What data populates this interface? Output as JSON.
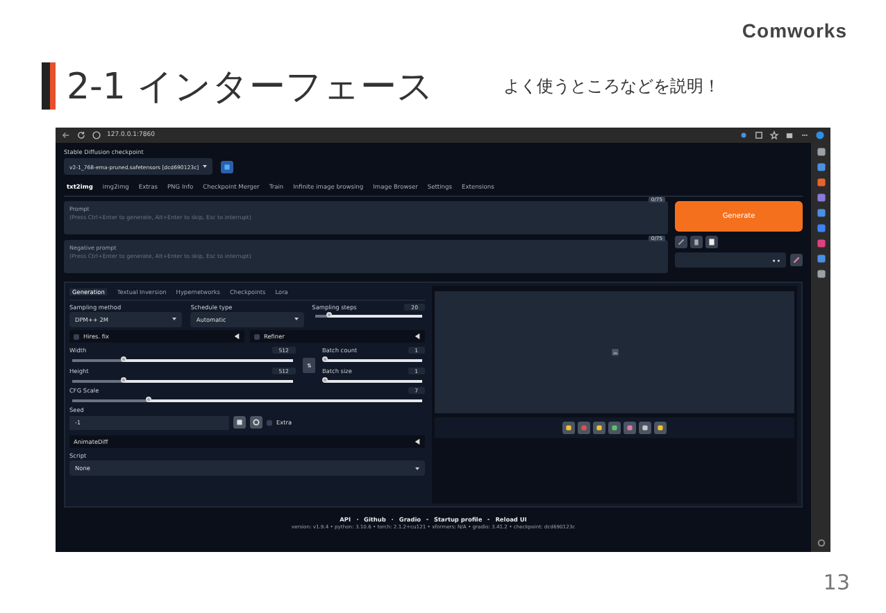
{
  "slide": {
    "logo": "Comworks",
    "title": "2-1 インターフェース",
    "subtitle": "よく使うところなどを説明！",
    "page_number": "13"
  },
  "browser": {
    "address": "127.0.0.1:7860"
  },
  "checkpoint": {
    "label": "Stable Diffusion checkpoint",
    "value": "v2-1_768-ema-pruned.safetensors [dcd690123c]"
  },
  "tabs": [
    {
      "label": "txt2img",
      "selected": true
    },
    {
      "label": "img2img",
      "selected": false
    },
    {
      "label": "Extras",
      "selected": false
    },
    {
      "label": "PNG Info",
      "selected": false
    },
    {
      "label": "Checkpoint Merger",
      "selected": false
    },
    {
      "label": "Train",
      "selected": false
    },
    {
      "label": "Infinite image browsing",
      "selected": false
    },
    {
      "label": "Image Browser",
      "selected": false
    },
    {
      "label": "Settings",
      "selected": false
    },
    {
      "label": "Extensions",
      "selected": false
    }
  ],
  "prompts": [
    {
      "label": "Prompt",
      "placeholder": "(Press Ctrl+Enter to generate, Alt+Enter to skip, Esc to interrupt)",
      "counter": "0/75"
    },
    {
      "label": "Negative prompt",
      "placeholder": "(Press Ctrl+Enter to generate, Alt+Enter to skip, Esc to interrupt)",
      "counter": "0/75"
    }
  ],
  "generate_button": "Generate",
  "sub_tabs": [
    {
      "label": "Generation",
      "selected": true
    },
    {
      "label": "Textual Inversion",
      "selected": false
    },
    {
      "label": "Hypernetworks",
      "selected": false
    },
    {
      "label": "Checkpoints",
      "selected": false
    },
    {
      "label": "Lora",
      "selected": false
    }
  ],
  "sampling_method": {
    "label": "Sampling method",
    "value": "DPM++ 2M"
  },
  "schedule_type": {
    "label": "Schedule type",
    "value": "Automatic"
  },
  "sampling_steps": {
    "label": "Sampling steps",
    "value": "20",
    "level": 0.13
  },
  "toggles": [
    {
      "label": "Hires. fix",
      "checked": false
    },
    {
      "label": "Refiner",
      "checked": false
    }
  ],
  "width": {
    "label": "Width",
    "value": "512",
    "level": 0.23
  },
  "height": {
    "label": "Height",
    "value": "512",
    "level": 0.23
  },
  "swap_button": "⇅",
  "batch_count": {
    "label": "Batch count",
    "value": "1",
    "level": 0
  },
  "batch_size": {
    "label": "Batch size",
    "value": "1",
    "level": 0
  },
  "cfg_scale": {
    "label": "CFG Scale",
    "value": "7",
    "level": 0.22
  },
  "seed": {
    "label": "Seed",
    "value": "-1",
    "extra_label": "Extra",
    "extra_checked": false
  },
  "animatediff": {
    "label": "AnimateDiff"
  },
  "script": {
    "label": "Script",
    "value": "None"
  },
  "footer": {
    "links": [
      "API",
      "Github",
      "Gradio",
      "Startup profile",
      "Reload UI"
    ],
    "version": "version: v1.9.4  •  python: 3.10.6  •  torch: 2.1.2+cu121  •  xformers: N/A  •  gradio: 3.41.2  •  checkpoint: dcd690123c"
  }
}
